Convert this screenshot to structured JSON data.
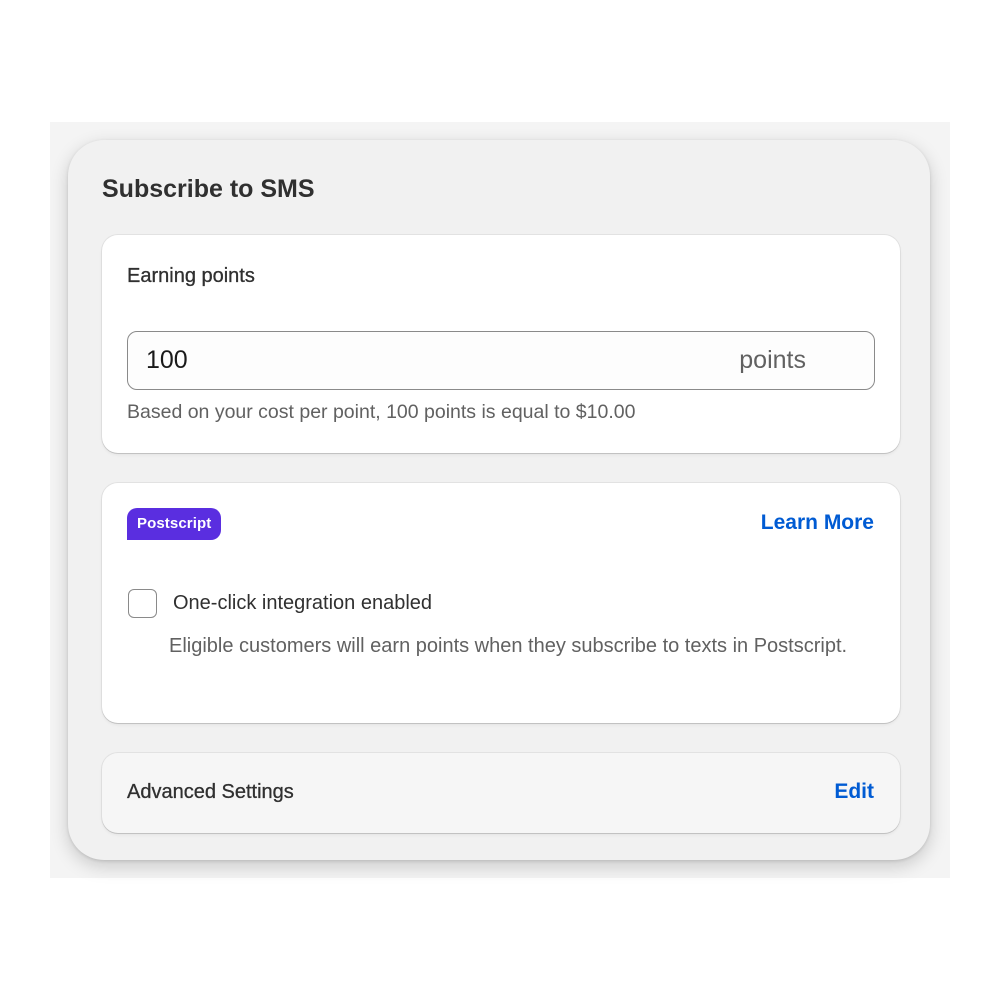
{
  "panel": {
    "title": "Subscribe to SMS"
  },
  "earning": {
    "heading": "Earning points",
    "value": "100",
    "suffix": "points",
    "help": "Based on your cost per point, 100 points is equal to $10.00"
  },
  "integration": {
    "badge": "Postscript",
    "learn_more": "Learn More",
    "checkbox_label": "One-click integration enabled",
    "checkbox_checked": false,
    "checkbox_help": "Eligible customers will earn points when they subscribe to texts in Postscript."
  },
  "advanced": {
    "label": "Advanced Settings",
    "edit": "Edit"
  },
  "colors": {
    "badge_bg": "#5a2ee0",
    "link": "#005bd3"
  }
}
